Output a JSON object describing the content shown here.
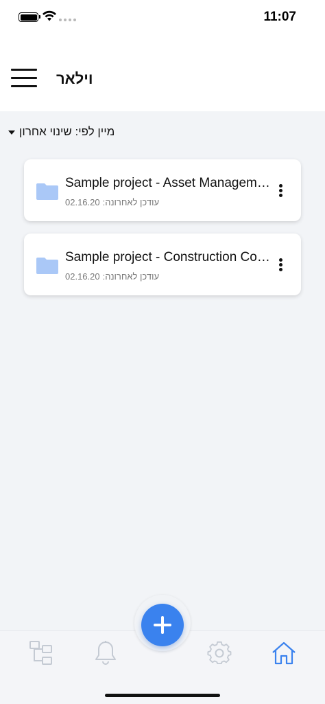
{
  "status_bar": {
    "time": "11:07"
  },
  "header": {
    "title": "וילאר",
    "menu_icon": "hamburger-icon"
  },
  "sort": {
    "label": "מיין לפי: שינוי אחרון"
  },
  "projects": [
    {
      "name": "Sample project - Asset Management",
      "updated_label": "עודכן לאחרונה:",
      "updated_date": "02.16.20",
      "icon": "folder-icon"
    },
    {
      "name": "Sample project - Construction Companies",
      "updated_label": "עודכן לאחרונה:",
      "updated_date": "02.16.20",
      "icon": "folder-icon"
    }
  ],
  "tab_bar": {
    "tabs": [
      "hierarchy-icon",
      "bell-icon",
      "add-icon",
      "gear-icon",
      "home-icon"
    ],
    "active_tab": "home-icon"
  },
  "colors": {
    "accent": "#3a82ee",
    "folder": "#aac8f7",
    "inactive_icon": "#c4cad3",
    "content_background": "#f2f4f7"
  }
}
